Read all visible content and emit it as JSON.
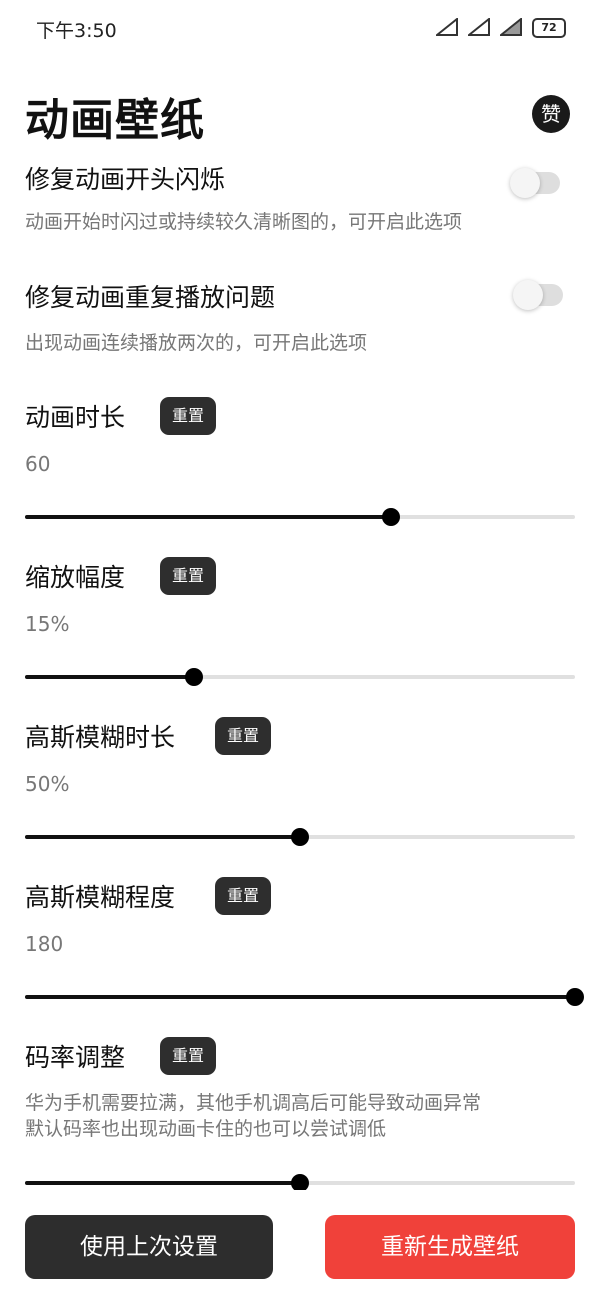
{
  "status_bar": {
    "time": "下午3:50",
    "battery": "72"
  },
  "header": {
    "title": "动画壁纸",
    "like_label": "赞"
  },
  "items": [
    {
      "title": "修复动画开头闪烁",
      "desc": "动画开始时闪过或持续较久清晰图的，可开启此选项",
      "toggle_on": false
    },
    {
      "title": "修复动画重复播放问题",
      "desc": "出现动画连续播放两次的，可开启此选项",
      "toggle_on": false
    }
  ],
  "sliders": [
    {
      "title": "动画时长",
      "reset_label": "重置",
      "value": "60",
      "fraction": 0.665
    },
    {
      "title": "缩放幅度",
      "reset_label": "重置",
      "value": "15%",
      "fraction": 0.307
    },
    {
      "title": "高斯模糊时长",
      "reset_label": "重置",
      "value": "50%",
      "fraction": 0.5
    },
    {
      "title": "高斯模糊程度",
      "reset_label": "重置",
      "value": "180",
      "fraction": 1.0
    },
    {
      "title": "码率调整",
      "reset_label": "重置",
      "desc_line1": "华为手机需要拉满，其他手机调高后可能导致动画异常",
      "desc_line2": "默认码率也出现动画卡住的也可以尝试调低",
      "fraction": 0.5
    }
  ],
  "buttons": {
    "use_last": "使用上次设置",
    "regenerate": "重新生成壁纸"
  }
}
